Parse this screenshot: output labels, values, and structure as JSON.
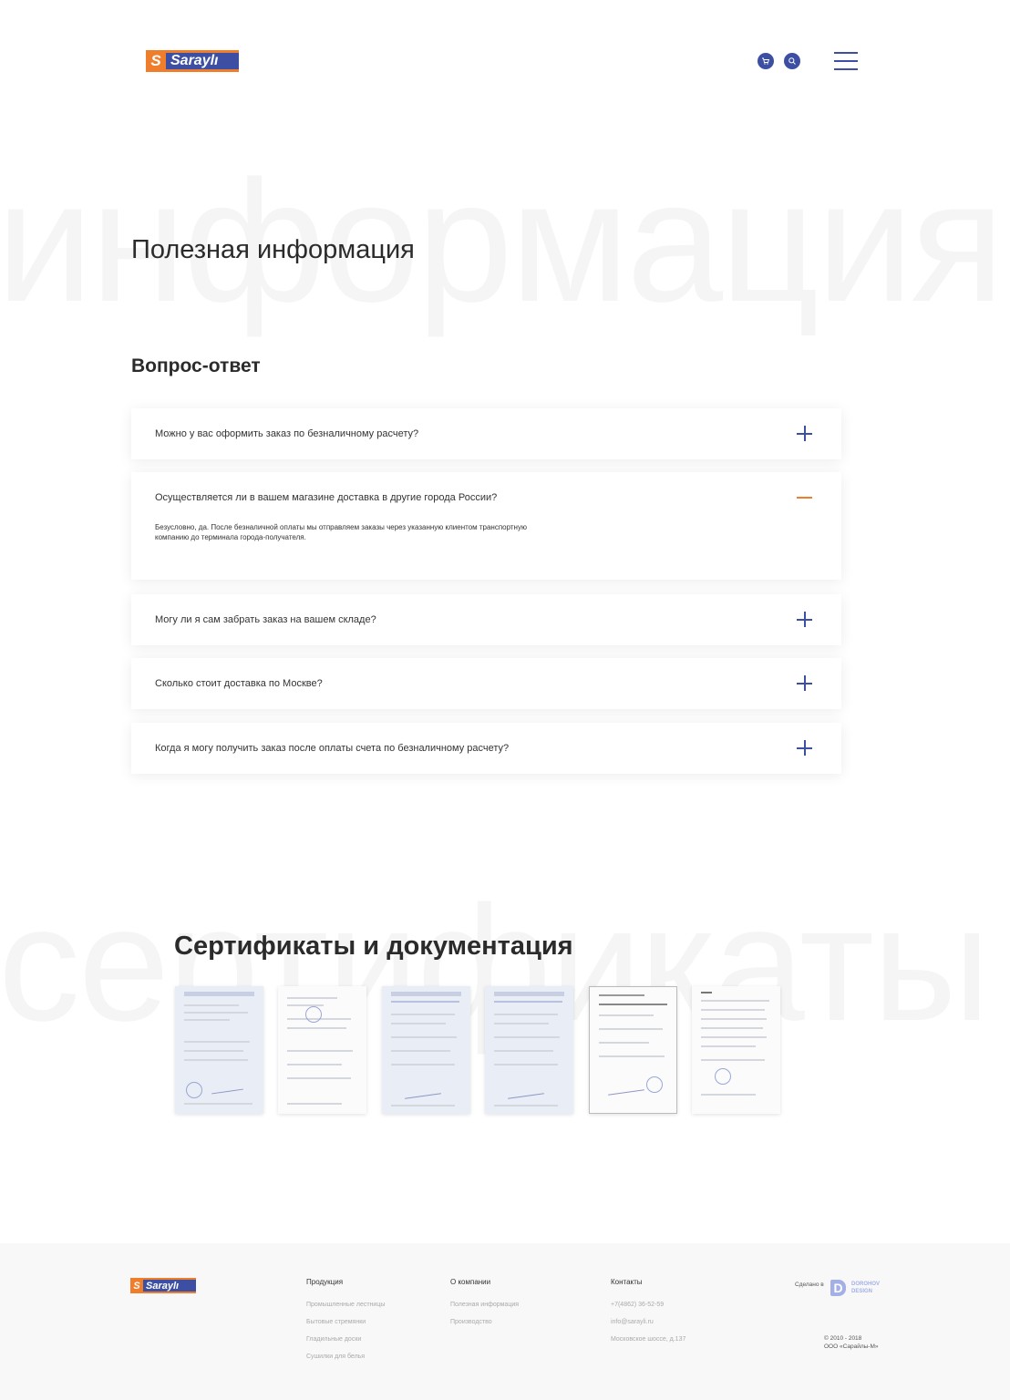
{
  "header": {
    "logo_text": "Saraylı",
    "cart_icon": "cart-icon",
    "search_icon": "search-icon",
    "menu_icon": "hamburger-menu-icon"
  },
  "watermarks": {
    "top": "информация",
    "bottom": "сертификаты"
  },
  "page_title": "Полезная информация",
  "faq_section": {
    "title": "Вопрос-ответ",
    "items": [
      {
        "question": "Можно у вас оформить заказ по безналичному расчету?",
        "open": false
      },
      {
        "question": "Осуществляется ли в вашем магазине доставка в другие города России?",
        "open": true,
        "answer": "Безусловно, да. После безналичной оплаты мы отправляем заказы через указанную клиентом транспортную компанию до терминала города-получателя."
      },
      {
        "question": "Могу ли я сам забрать заказ на вашем складе?",
        "open": false
      },
      {
        "question": "Сколько стоит доставка по Москве?",
        "open": false
      },
      {
        "question": "Когда я могу получить заказ после оплаты счета по безналичному расчету?",
        "open": false
      }
    ]
  },
  "certificates": {
    "title": "Сертификаты и документация",
    "count": 6
  },
  "footer": {
    "logo_text": "Saraylı",
    "columns": [
      {
        "heading": "Продукция",
        "items": [
          "Промышленные лестницы",
          "Бытовые стремянки",
          "Гладильные доски",
          "Сушилки для белья"
        ]
      },
      {
        "heading": "О компании",
        "items": [
          "Полезная информация",
          "Производство"
        ]
      },
      {
        "heading": "Контакты",
        "items": [
          "+7(4862) 36-52-59",
          "info@sarayli.ru",
          "Московское шоссе, д.137"
        ]
      }
    ],
    "made_by": "Сделано в",
    "studio_line1": "DOROHOV",
    "studio_line2": "DESIGN",
    "copyright_line1": "© 2010 - 2018",
    "copyright_line2": "ООО «Сарайлы-М»"
  },
  "colors": {
    "brand_blue": "#3c4fa3",
    "brand_orange": "#ee7d2c"
  }
}
